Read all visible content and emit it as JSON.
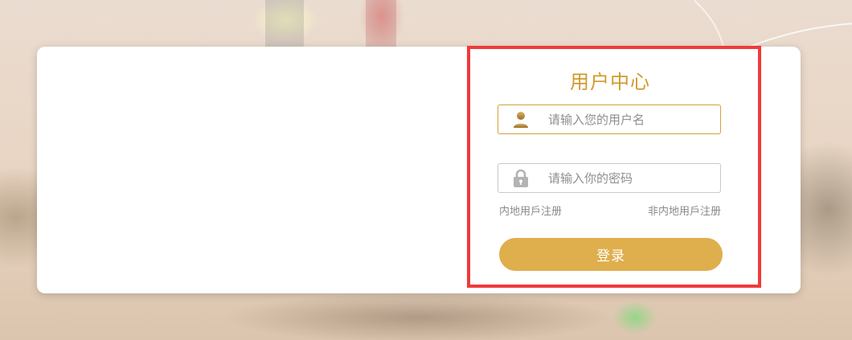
{
  "login": {
    "title": "用户中心",
    "username": {
      "placeholder": "请输入您的用户名",
      "value": "",
      "icon": "user-icon"
    },
    "password": {
      "placeholder": "请输入你的密码",
      "value": "",
      "icon": "lock-icon"
    },
    "links": {
      "mainland_register": "内地用戶注册",
      "non_mainland_register": "非内地用戶注册"
    },
    "submit_label": "登录"
  },
  "colors": {
    "accent": "#d19a2b",
    "button": "#dfae4d",
    "highlight_border": "#f03a3a"
  }
}
